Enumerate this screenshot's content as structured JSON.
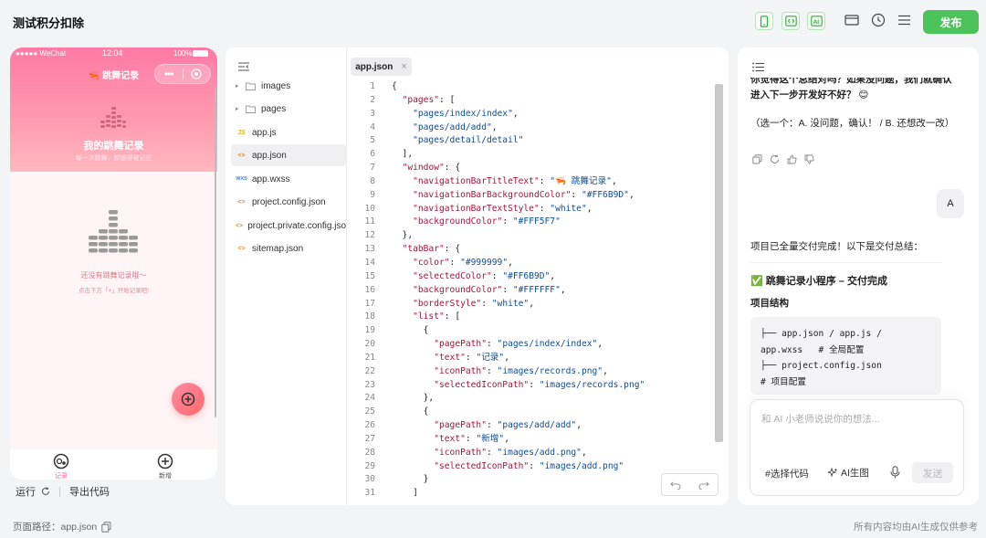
{
  "app": {
    "title": "测试积分扣除"
  },
  "toolbar": {
    "publish_label": "发布",
    "icons": [
      "phone-preview-icon",
      "code-view-icon",
      "ai-view-icon",
      "window-icon",
      "history-icon",
      "menu-icon"
    ]
  },
  "simulator": {
    "status_left": "●●●●● WeChat",
    "status_time": "12:04",
    "status_battery": "100%",
    "nav_title": "🦐 跳舞记录",
    "hero_title": "我的跳舞记录",
    "hero_subtitle": "每一次跳舞，都值得被记住",
    "empty_title": "还没有跳舞记录哦～",
    "empty_hint": "点击下方「+」开始记录吧!",
    "tabs": [
      {
        "label": "记录",
        "color": "#FF6B9D"
      },
      {
        "label": "新增",
        "color": "#999999"
      }
    ],
    "run_label": "运行",
    "export_label": "导出代码"
  },
  "file_tree": [
    {
      "name": "images",
      "type": "folder"
    },
    {
      "name": "pages",
      "type": "folder"
    },
    {
      "name": "app.js",
      "type": "js"
    },
    {
      "name": "app.json",
      "type": "json",
      "active": true
    },
    {
      "name": "app.wxss",
      "type": "wxss"
    },
    {
      "name": "project.config.json",
      "type": "json"
    },
    {
      "name": "project.private.config.json",
      "type": "json"
    },
    {
      "name": "sitemap.json",
      "type": "json"
    }
  ],
  "editor": {
    "active_tab": "app.json",
    "lines": [
      "{",
      "  \"pages\": [",
      "    \"pages/index/index\",",
      "    \"pages/add/add\",",
      "    \"pages/detail/detail\"",
      "  ],",
      "  \"window\": {",
      "    \"navigationBarTitleText\": \"🦐 跳舞记录\",",
      "    \"navigationBarBackgroundColor\": \"#FF6B9D\",",
      "    \"navigationBarTextStyle\": \"white\",",
      "    \"backgroundColor\": \"#FFF5F7\"",
      "  },",
      "  \"tabBar\": {",
      "    \"color\": \"#999999\",",
      "    \"selectedColor\": \"#FF6B9D\",",
      "    \"backgroundColor\": \"#FFFFFF\",",
      "    \"borderStyle\": \"white\",",
      "    \"list\": [",
      "      {",
      "        \"pagePath\": \"pages/index/index\",",
      "        \"text\": \"记录\",",
      "        \"iconPath\": \"images/records.png\",",
      "        \"selectedIconPath\": \"images/records.png\"",
      "      },",
      "      {",
      "        \"pagePath\": \"pages/add/add\",",
      "        \"text\": \"新增\",",
      "        \"iconPath\": \"images/add.png\",",
      "        \"selectedIconPath\": \"images/add.png\"",
      "      }",
      "    ]"
    ]
  },
  "chat": {
    "assistant_msg_1": "你觉得这个总结对吗？如果没问题，我们就确认进入下一步开发好不好？ 😊",
    "assistant_msg_2": "（选一个：A. 没问题，确认！ / B. 还想改一改）",
    "user_reply": "A",
    "delivery_intro": "项目已全量交付完成！以下是交付总结：",
    "delivery_title": "✅ 跳舞记录小程序 – 交付完成",
    "structure_heading": "项目结构",
    "structure_code": "├── app.json / app.js /\napp.wxss   # 全局配置\n├── project.config.json\n# 项目配置",
    "input_placeholder": "和 AI 小老师说说你的想法...",
    "select_code_label": "#选择代码",
    "ai_image_label": "AI生图",
    "send_label": "发送"
  },
  "footer": {
    "page_path": "页面路径：app.json",
    "disclaimer": "所有内容均由AI生成仅供参考"
  },
  "colors": {
    "accent_green": "#4CC35A",
    "brand_pink": "#FF6B9D"
  }
}
